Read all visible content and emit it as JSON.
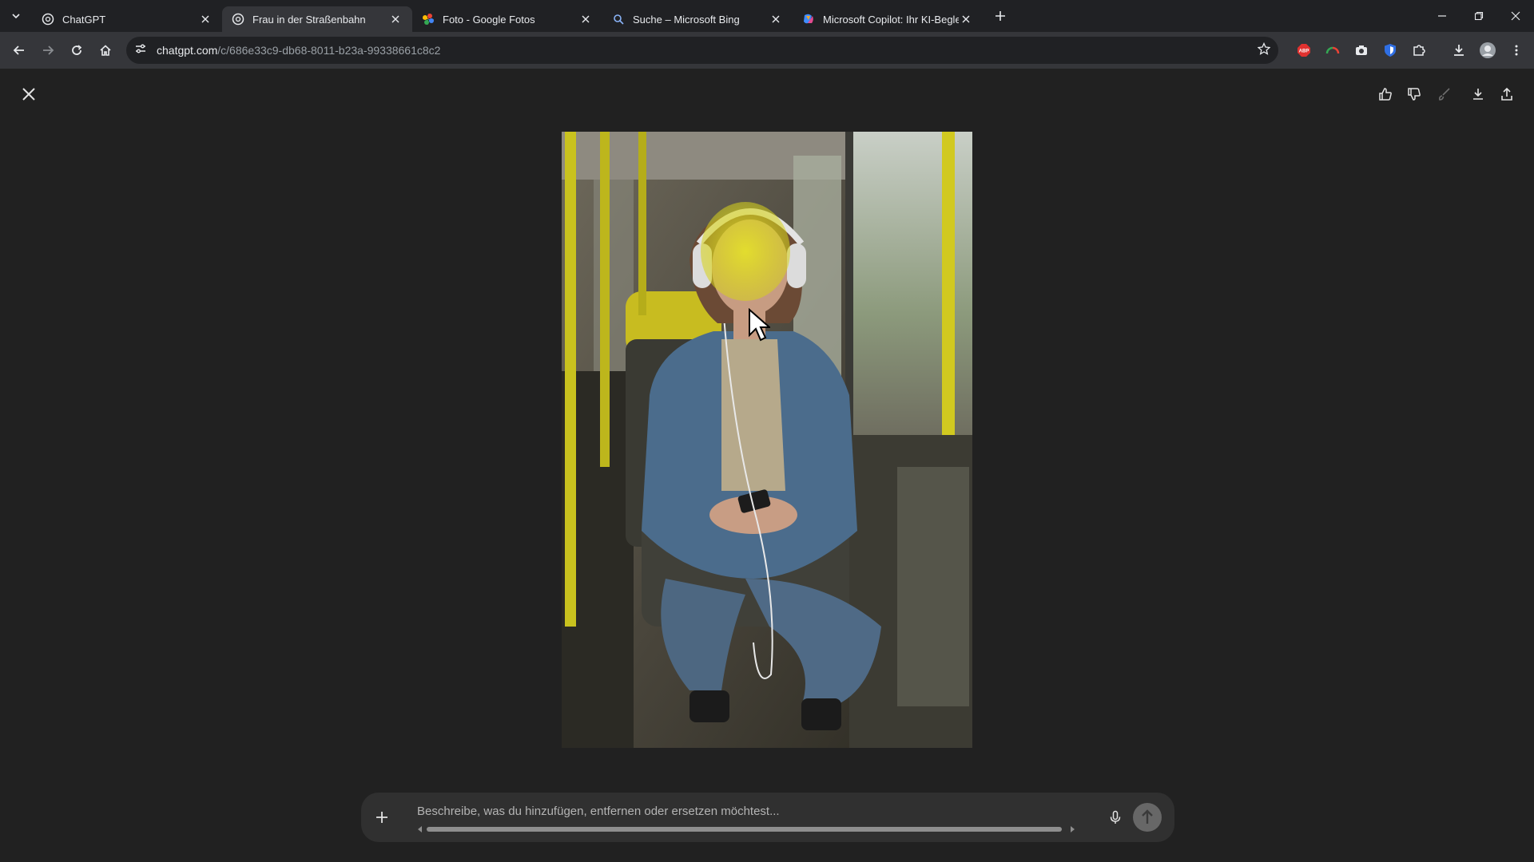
{
  "browser": {
    "tabs": [
      {
        "title": "ChatGPT",
        "icon": "openai-icon",
        "active": false
      },
      {
        "title": "Frau in der Straßenbahn",
        "icon": "openai-icon",
        "active": true
      },
      {
        "title": "Foto - Google Fotos",
        "icon": "google-photos-icon",
        "active": false
      },
      {
        "title": "Suche – Microsoft Bing",
        "icon": "search-icon",
        "active": false
      },
      {
        "title": "Microsoft Copilot: Ihr KI-Begleiter",
        "icon": "copilot-icon",
        "active": false
      }
    ],
    "url_host": "chatgpt.com",
    "url_path": "/c/686e33c9-db68-8011-b23a-99338661c8c2",
    "extensions": [
      "adblock-icon",
      "gauge-icon",
      "camera-icon",
      "shield-icon",
      "puzzle-icon"
    ]
  },
  "editor": {
    "image_alt": "Frau in der Straßenbahn",
    "prompt_placeholder": "Beschreibe, was du hinzufügen, entfernen oder ersetzen möchtest..."
  },
  "colors": {
    "accent_yellow": "#d6d21a",
    "background": "#212121",
    "composer": "#303030"
  }
}
